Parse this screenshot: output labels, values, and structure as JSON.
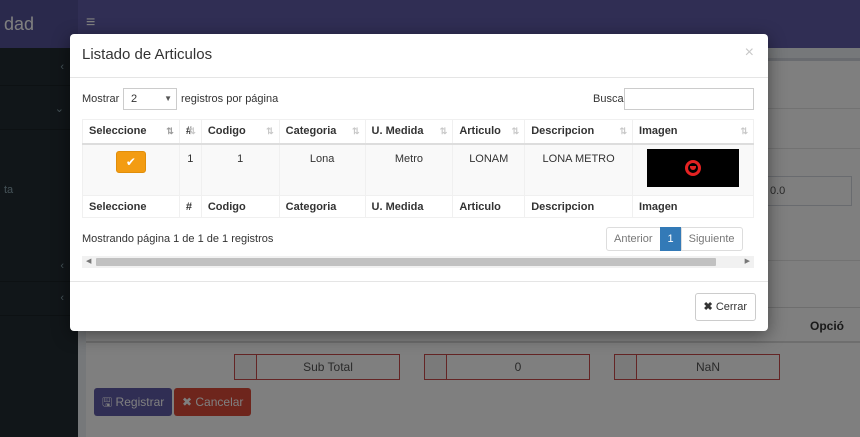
{
  "app": {
    "brand": "dad",
    "toggle_icon": "≡"
  },
  "background": {
    "opcion_header": "Opció",
    "field_value": "0.0",
    "totals": [
      {
        "label": "Sub Total"
      },
      {
        "label": "0"
      },
      {
        "label": "NaN"
      }
    ],
    "buttons": {
      "registrar": "🖫 Registrar",
      "cancelar": "✖ Cancelar"
    },
    "sidebar_text": "ta"
  },
  "modal": {
    "title": "Listado de Articulos",
    "close_icon": "×",
    "length_label": "Mostrar",
    "length_value": "2",
    "length_suffix": "registros por página",
    "search_label": "Buscar",
    "search_value": "",
    "columns": [
      "Seleccione",
      "#",
      "Codigo",
      "Categoria",
      "U. Medida",
      "Articulo",
      "Descripcion",
      "Imagen"
    ],
    "rows": [
      {
        "num": "1",
        "codigo": "1",
        "categoria": "Lona",
        "medida": "Metro",
        "articulo": "LONAM",
        "descripcion": "LONA METRO"
      }
    ],
    "select_icon": "✔",
    "info": "Mostrando página 1 de 1 de 1 registros",
    "pagination": {
      "previous": "Anterior",
      "current": "1",
      "next": "Siguiente"
    },
    "footer_close": "Cerrar",
    "footer_close_icon": "✖"
  },
  "colors": {
    "header": "#605ca8",
    "sidebar": "#222d32",
    "select_button": "#f39c12",
    "page_active": "#337ab7"
  }
}
